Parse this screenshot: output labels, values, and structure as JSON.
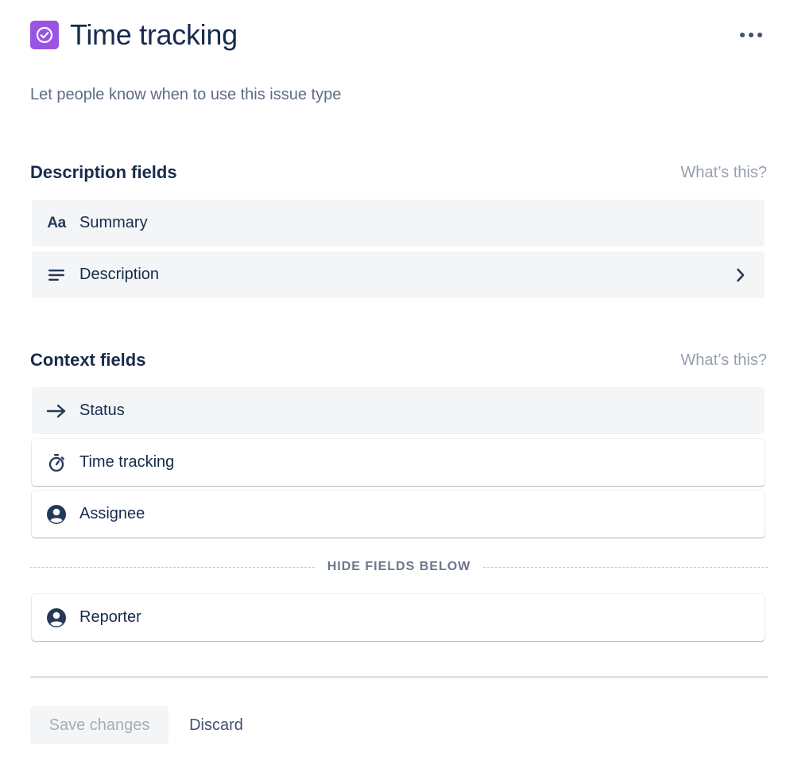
{
  "header": {
    "title": "Time tracking",
    "icon": "check-circle-icon",
    "icon_color": "#9954E3",
    "more_icon": "more-horizontal-icon"
  },
  "subtitle": "Let people know when to use this issue type",
  "description_section": {
    "title": "Description fields",
    "help_link": "What’s this?",
    "fields": [
      {
        "label": "Summary",
        "icon": "text-format-icon",
        "icon_text": "Aa"
      },
      {
        "label": "Description",
        "icon": "text-lines-icon",
        "has_chevron": true
      }
    ]
  },
  "context_section": {
    "title": "Context fields",
    "help_link": "What’s this?",
    "fields": [
      {
        "label": "Status",
        "icon": "arrow-right-icon"
      },
      {
        "label": "Time tracking",
        "icon": "stopwatch-icon"
      },
      {
        "label": "Assignee",
        "icon": "person-circle-icon"
      }
    ],
    "hide_divider_label": "HIDE FIELDS BELOW",
    "hidden_fields": [
      {
        "label": "Reporter",
        "icon": "person-circle-icon"
      }
    ]
  },
  "footer": {
    "save_label": "Save changes",
    "discard_label": "Discard"
  },
  "colors": {
    "primary_text": "#172B4D",
    "secondary_text": "#5E6C84",
    "muted_text": "#97A0AF",
    "locked_field_bg": "#F4F5F7"
  }
}
